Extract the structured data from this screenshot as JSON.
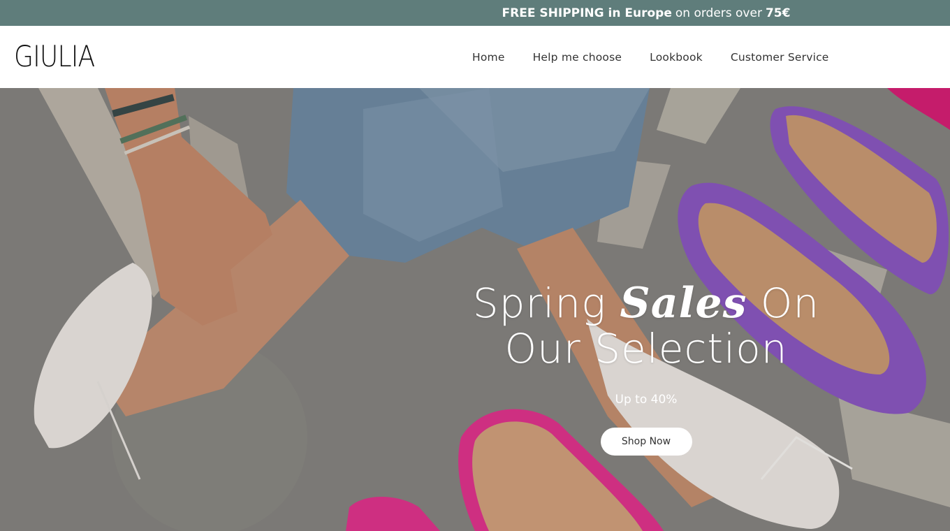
{
  "announcement": {
    "part1": "FREE SHIPPING in Europe",
    "part2": "on orders over",
    "part3": "75€",
    "background": "#5f7d7b"
  },
  "header": {
    "logo": "GIULIA",
    "nav": [
      {
        "label": "Home"
      },
      {
        "label": "Help me choose"
      },
      {
        "label": "Lookbook"
      },
      {
        "label": "Customer Service"
      }
    ]
  },
  "hero": {
    "headline_prefix": "Spring",
    "headline_italic": "Sales",
    "headline_suffix": "On",
    "headline_line2": "Our Selection",
    "subline": "Up to 40%",
    "cta": "Shop Now",
    "image_description_icon": "hero-photo",
    "colors": {
      "floor": "#8a8984",
      "denim": "#6f8aa3",
      "skin": "#c48f6f",
      "shoe_cream": "#ece7e2",
      "shoe_purple": "#8a57c0",
      "shoe_pink": "#e0338d"
    }
  }
}
